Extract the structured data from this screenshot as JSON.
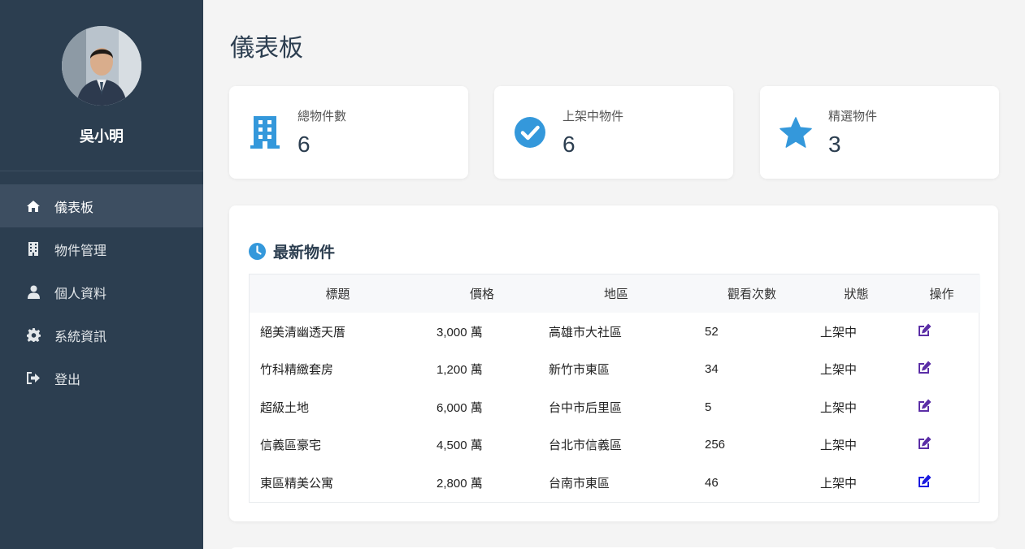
{
  "sidebar": {
    "user_name": "吳小明",
    "nav": [
      {
        "label": "儀表板",
        "icon": "home-icon",
        "active": true
      },
      {
        "label": "物件管理",
        "icon": "building-icon"
      },
      {
        "label": "個人資料",
        "icon": "user-icon"
      },
      {
        "label": "系統資訊",
        "icon": "gear-icon"
      },
      {
        "label": "登出",
        "icon": "sign-out-icon"
      }
    ]
  },
  "page": {
    "title": "儀表板"
  },
  "stats": [
    {
      "label": "總物件數",
      "value": "6",
      "icon": "building-icon"
    },
    {
      "label": "上架中物件",
      "value": "6",
      "icon": "check-circle-icon"
    },
    {
      "label": "精選物件",
      "value": "3",
      "icon": "star-icon"
    }
  ],
  "latest": {
    "title": "最新物件",
    "columns": [
      "標題",
      "價格",
      "地區",
      "觀看次數",
      "狀態",
      "操作"
    ],
    "rows": [
      {
        "title": "絕美清幽透天厝",
        "price": "3,000 萬",
        "region": "高雄市大社區",
        "views": "52",
        "status": "上架中"
      },
      {
        "title": "竹科精緻套房",
        "price": "1,200 萬",
        "region": "新竹市東區",
        "views": "34",
        "status": "上架中"
      },
      {
        "title": "超級土地",
        "price": "6,000 萬",
        "region": "台中市后里區",
        "views": "5",
        "status": "上架中"
      },
      {
        "title": "信義區豪宅",
        "price": "4,500 萬",
        "region": "台北市信義區",
        "views": "256",
        "status": "上架中"
      },
      {
        "title": "東區精美公寓",
        "price": "2,800 萬",
        "region": "台南市東區",
        "views": "46",
        "status": "上架中"
      }
    ]
  },
  "colors": {
    "sidebar": "#2c3e50",
    "accent": "#3498db",
    "edit_icon": "#5b2ea6",
    "edit_icon_last": "#1a1adf"
  }
}
